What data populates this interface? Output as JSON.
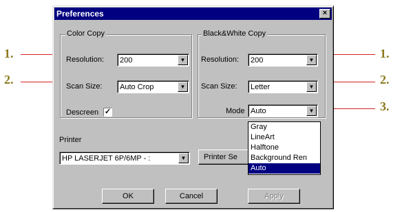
{
  "window": {
    "title": "Preferences",
    "close_glyph": "×"
  },
  "color_copy": {
    "group_label": "Color Copy",
    "resolution_label": "Resolution:",
    "resolution_value": "200",
    "scan_size_label": "Scan Size:",
    "scan_size_value": "Auto Crop",
    "descreen_label": "Descreen",
    "descreen_checked_glyph": "✓"
  },
  "bw_copy": {
    "group_label": "Black&White Copy",
    "resolution_label": "Resolution:",
    "resolution_value": "200",
    "scan_size_label": "Scan Size:",
    "scan_size_value": "Letter",
    "mode_label": "Mode",
    "mode_value": "Auto",
    "mode_options": [
      "Gray",
      "LineArt",
      "Halftone",
      "Background Ren",
      "Auto"
    ],
    "mode_selected_index": 4
  },
  "printer": {
    "label": "Printer",
    "value": "HP LASERJET 6P/6MP - :",
    "setup_button": "Printer Se"
  },
  "buttons": {
    "ok": "OK",
    "cancel": "Cancel",
    "apply": "Apply"
  },
  "callouts": {
    "left": [
      "1.",
      "2."
    ],
    "right": [
      "1.",
      "2.",
      "3."
    ]
  },
  "colors": {
    "title_bar": "#000080",
    "dialog_face": "#c0c0c0",
    "callout_text": "#8b7a1e",
    "callout_line": "#d22020"
  },
  "icons": {
    "dropdown_arrow": "▼"
  }
}
